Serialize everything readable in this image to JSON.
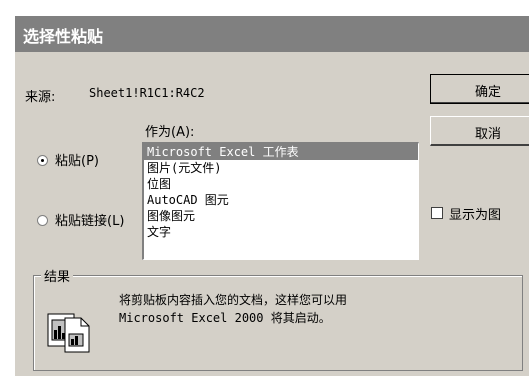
{
  "dialog": {
    "title": "选择性粘贴",
    "source_label": "来源:",
    "source_value": "Sheet1!R1C1:R4C2",
    "as_label": "作为(A):"
  },
  "options": {
    "paste": {
      "label": "粘贴(P)",
      "checked": true
    },
    "paste_link": {
      "label": "粘贴链接(L)",
      "checked": false
    }
  },
  "list": {
    "items": [
      "Microsoft Excel 工作表",
      "图片(元文件)",
      "位图",
      "AutoCAD 图元",
      "图像图元",
      "文字"
    ],
    "selected_index": 0
  },
  "buttons": {
    "ok": "确定",
    "cancel": "取消"
  },
  "checkbox": {
    "label": "显示为图",
    "checked": false
  },
  "result": {
    "legend": "结果",
    "line1": "将剪贴板内容插入您的文档，这样您可以用",
    "line2": "Microsoft Excel 2000 将其启动。"
  },
  "icons": {
    "radio_checked": "radio-selected",
    "radio_unchecked": "radio-empty",
    "result_icon": "paste-document-icon"
  }
}
